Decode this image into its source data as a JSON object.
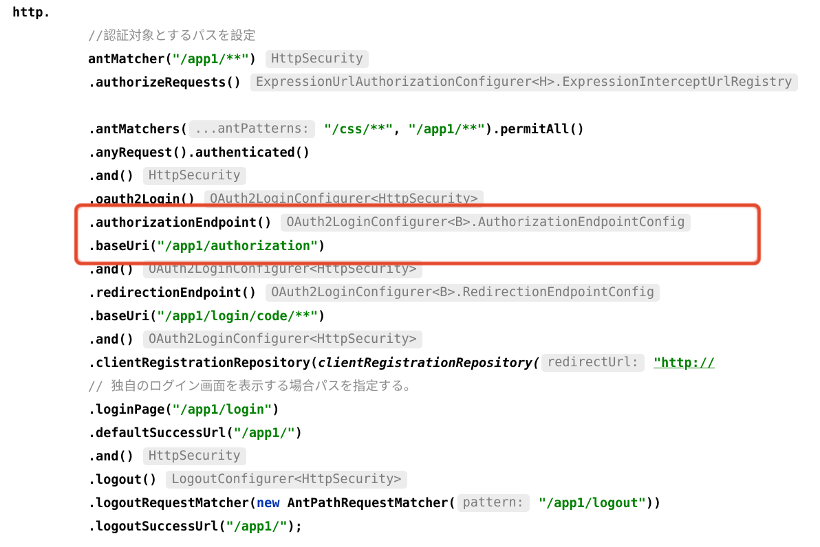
{
  "t": {
    "http": "http.",
    "c1": "//認証対象とするパスを設定",
    "antMatcher1": "antMatcher(",
    "antMatcher1str": "\"/app1/**\"",
    "antMatcher1close": ")",
    "h_httpSec": "HttpSecurity",
    "authReq": ".authorizeRequests()",
    "h_expr": "ExpressionUrlAuthorizationConfigurer<H>.ExpressionInterceptUrlRegistry",
    "antMatchers": ".antMatchers(",
    "h_antPat": "...antPatterns:",
    "css": "\"/css/**\"",
    "comma": ", ",
    "app1glob": "\"/app1/**\"",
    "permitAll": ").permitAll()",
    "anyReq": ".anyRequest().authenticated()",
    "and": ".and()",
    "h_oauth": "OAuth2LoginConfigurer<HttpSecurity>",
    "h_oauthB_auth": "OAuth2LoginConfigurer<B>.AuthorizationEndpointConfig",
    "h_oauthB_red": "OAuth2LoginConfigurer<B>.RedirectionEndpointConfig",
    "oauth2": ".oauth2Login()",
    "authEp": ".authorizationEndpoint()",
    "base1": ".baseUri(",
    "base1str": "\"/app1/authorization\"",
    "close": ")",
    "redEp": ".redirectionEndpoint()",
    "base2": ".baseUri(",
    "base2str": "\"/app1/login/code/**\"",
    "crr": ".clientRegistrationRepository(",
    "crrIt": "clientRegistrationRepository(",
    "h_redir": "redirectUrl:",
    "url": "\"http://",
    "c2": "//  独自のログイン画面を表示する場合パスを指定する。",
    "login": ".loginPage(",
    "loginstr": "\"/app1/login\"",
    "defSucc": ".defaultSuccessUrl(",
    "defSuccstr": "\"/app1/\"",
    "logout": ".logout()",
    "h_logout": "LogoutConfigurer<HttpSecurity>",
    "lrm": ".logoutRequestMatcher(",
    "new": "new",
    "ant": " AntPathRequestMatcher(",
    "h_pat": "pattern:",
    "logoutstr": "\"/app1/logout\"",
    "rrparen": "))",
    "lsu": ".logoutSuccessUrl(",
    "lsustr": "\"/app1/\"",
    "end": ");"
  }
}
